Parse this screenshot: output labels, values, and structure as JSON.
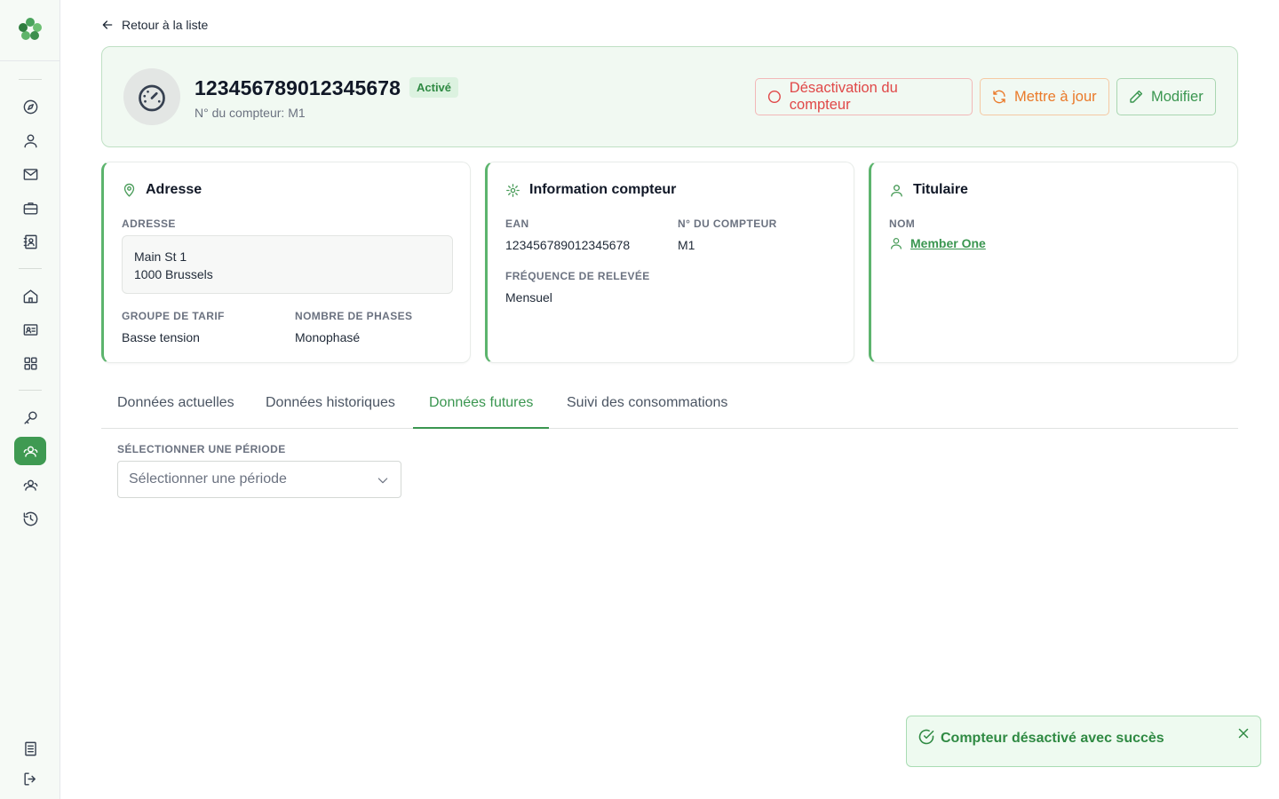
{
  "back_link": {
    "label": "Retour à la liste"
  },
  "header": {
    "meter_id": "123456789012345678",
    "status": "Activé",
    "subtitle": "N° du compteur: M1",
    "buttons": {
      "deactivate": "Désactivation du compteur",
      "update": "Mettre à jour",
      "edit": "Modifier"
    }
  },
  "address_card": {
    "title": "Adresse",
    "address_label": "ADRESSE",
    "address_line1": "Main St 1",
    "address_line2": "1000 Brussels",
    "tariff_label": "GROUPE DE TARIF",
    "tariff_value": "Basse tension",
    "phases_label": "NOMBRE DE PHASES",
    "phases_value": "Monophasé"
  },
  "meter_card": {
    "title": "Information compteur",
    "ean_label": "EAN",
    "ean_value": "123456789012345678",
    "number_label": "N° DU COMPTEUR",
    "number_value": "M1",
    "frequency_label": "FRÉQUENCE DE RELEVÉE",
    "frequency_value": "Mensuel"
  },
  "holder_card": {
    "title": "Titulaire",
    "name_label": "NOM",
    "name_value": "Member One"
  },
  "tabs": [
    {
      "label": "Données actuelles",
      "active": false
    },
    {
      "label": "Données historiques",
      "active": false
    },
    {
      "label": "Données futures",
      "active": true
    },
    {
      "label": "Suivi des consommations",
      "active": false
    }
  ],
  "period": {
    "label": "SÉLECTIONNER UNE PÉRIODE",
    "placeholder": "Sélectionner une période"
  },
  "toast": {
    "message": "Compteur désactivé avec succès"
  },
  "colors": {
    "accent": "#3f9a52",
    "danger": "#e04848",
    "warning": "#ea7a2a"
  }
}
